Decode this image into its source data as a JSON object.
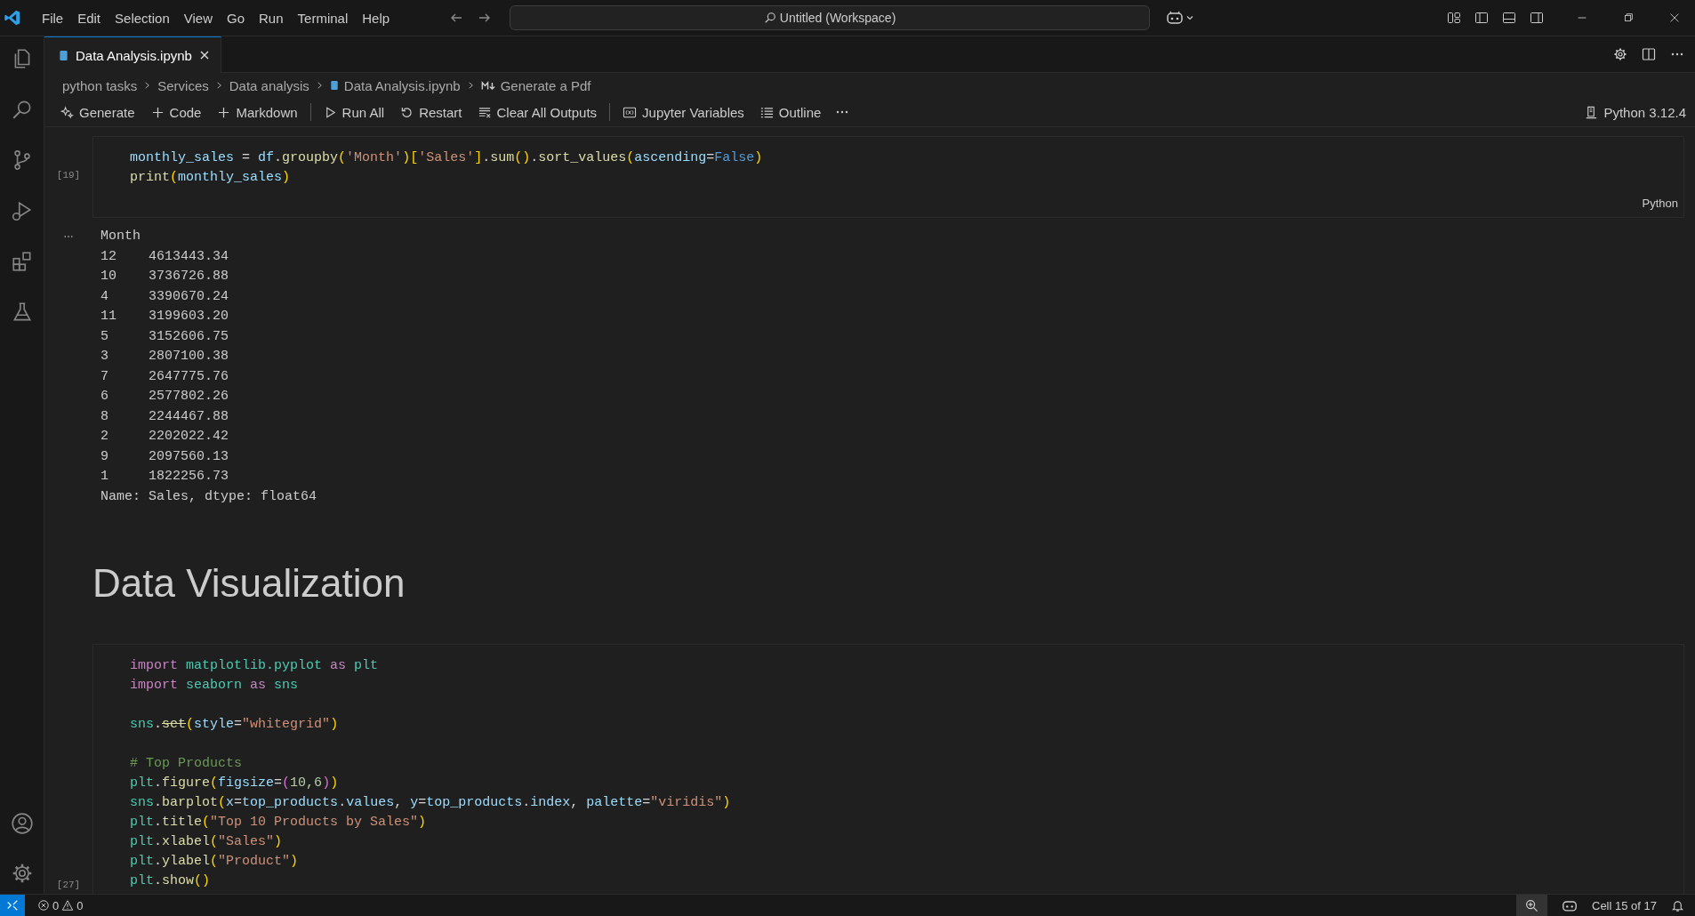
{
  "title_bar": {
    "menu": [
      "File",
      "Edit",
      "Selection",
      "View",
      "Go",
      "Run",
      "Terminal",
      "Help"
    ],
    "command_center": "Untitled (Workspace)"
  },
  "tabs": [
    {
      "label": "Data Analysis.ipynb",
      "selected": true
    }
  ],
  "breadcrumbs": [
    {
      "label": "python tasks",
      "kind": "folder"
    },
    {
      "label": "Services",
      "kind": "folder"
    },
    {
      "label": "Data analysis",
      "kind": "folder"
    },
    {
      "label": "Data Analysis.ipynb",
      "kind": "notebook"
    },
    {
      "label": "Generate a Pdf",
      "kind": "markdown"
    }
  ],
  "toolbar": {
    "groups": [
      [
        {
          "label": "Generate",
          "kind": "generate"
        },
        {
          "label": "Code",
          "kind": "add"
        },
        {
          "label": "Markdown",
          "kind": "add"
        }
      ],
      [
        {
          "label": "Run All",
          "kind": "run"
        },
        {
          "label": "Restart",
          "kind": "restart"
        },
        {
          "label": "Clear All Outputs",
          "kind": "clear"
        }
      ],
      [
        {
          "label": "Jupyter Variables",
          "kind": "variables"
        },
        {
          "label": "Outline",
          "kind": "outline"
        }
      ]
    ],
    "kernel": "Python 3.12.4"
  },
  "cells": [
    {
      "kind": "code",
      "execution_count": "[19]",
      "language": "Python",
      "lines": [
        {
          "tokens": [
            {
              "kind": "var",
              "text": "monthly_sales"
            },
            {
              "kind": "plain",
              "text": " = "
            },
            {
              "kind": "var",
              "text": "df"
            },
            {
              "kind": "plain",
              "text": "."
            },
            {
              "kind": "func",
              "text": "groupby"
            },
            {
              "kind": "bracket",
              "text": "("
            },
            {
              "kind": "string",
              "text": "'Month'"
            },
            {
              "kind": "bracket",
              "text": ")["
            },
            {
              "kind": "string",
              "text": "'Sales'"
            },
            {
              "kind": "bracket",
              "text": "]"
            },
            {
              "kind": "plain",
              "text": "."
            },
            {
              "kind": "func",
              "text": "sum"
            },
            {
              "kind": "bracket",
              "text": "()"
            },
            {
              "kind": "plain",
              "text": "."
            },
            {
              "kind": "func",
              "text": "sort_values"
            },
            {
              "kind": "bracket",
              "text": "("
            },
            {
              "kind": "param",
              "text": "ascending"
            },
            {
              "kind": "plain",
              "text": "="
            },
            {
              "kind": "const",
              "text": "False"
            },
            {
              "kind": "bracket",
              "text": ")"
            }
          ]
        },
        {
          "tokens": [
            {
              "kind": "func",
              "text": "print"
            },
            {
              "kind": "bracket",
              "text": "("
            },
            {
              "kind": "var",
              "text": "monthly_sales"
            },
            {
              "kind": "bracket",
              "text": ")"
            }
          ]
        }
      ],
      "output": [
        "Month",
        "12    4613443.34",
        "10    3736726.88",
        "4     3390670.24",
        "11    3199603.20",
        "5     3152606.75",
        "3     2807100.38",
        "7     2647775.76",
        "6     2577802.26",
        "8     2244467.88",
        "2     2202022.42",
        "9     2097560.13",
        "1     1822256.73",
        "Name: Sales, dtype: float64"
      ]
    },
    {
      "kind": "markdown",
      "heading": "Data Visualization"
    },
    {
      "kind": "code",
      "execution_count": "[27]",
      "lines": [
        {
          "tokens": [
            {
              "kind": "keyword",
              "text": "import "
            },
            {
              "kind": "module",
              "text": "matplotlib.pyplot "
            },
            {
              "kind": "keyword",
              "text": "as "
            },
            {
              "kind": "module",
              "text": "plt"
            }
          ]
        },
        {
          "tokens": [
            {
              "kind": "keyword",
              "text": "import "
            },
            {
              "kind": "module",
              "text": "seaborn "
            },
            {
              "kind": "keyword",
              "text": "as "
            },
            {
              "kind": "module",
              "text": "sns"
            }
          ]
        },
        {
          "gap_before": true,
          "tokens": [
            {
              "kind": "module",
              "text": "sns"
            },
            {
              "kind": "plain",
              "text": "."
            },
            {
              "kind": "deprecated",
              "text": "set"
            },
            {
              "kind": "bracket",
              "text": "("
            },
            {
              "kind": "param",
              "text": "style"
            },
            {
              "kind": "plain",
              "text": "="
            },
            {
              "kind": "string",
              "text": "\"whitegrid\""
            },
            {
              "kind": "bracket",
              "text": ")"
            }
          ]
        },
        {
          "gap_before": true,
          "tokens": [
            {
              "kind": "comment",
              "text": "# Top Products"
            }
          ]
        },
        {
          "tokens": [
            {
              "kind": "module",
              "text": "plt"
            },
            {
              "kind": "plain",
              "text": "."
            },
            {
              "kind": "func",
              "text": "figure"
            },
            {
              "kind": "bracket",
              "text": "("
            },
            {
              "kind": "param",
              "text": "figsize"
            },
            {
              "kind": "plain",
              "text": "="
            },
            {
              "kind": "bracket2",
              "text": "("
            },
            {
              "kind": "number",
              "text": "10,6"
            },
            {
              "kind": "bracket2",
              "text": ")"
            },
            {
              "kind": "bracket",
              "text": ")"
            }
          ]
        },
        {
          "tokens": [
            {
              "kind": "module",
              "text": "sns"
            },
            {
              "kind": "plain",
              "text": "."
            },
            {
              "kind": "func",
              "text": "barplot"
            },
            {
              "kind": "bracket",
              "text": "("
            },
            {
              "kind": "param",
              "text": "x"
            },
            {
              "kind": "plain",
              "text": "="
            },
            {
              "kind": "var",
              "text": "top_products"
            },
            {
              "kind": "plain",
              "text": "."
            },
            {
              "kind": "var",
              "text": "values"
            },
            {
              "kind": "plain",
              "text": ", "
            },
            {
              "kind": "param",
              "text": "y"
            },
            {
              "kind": "plain",
              "text": "="
            },
            {
              "kind": "var",
              "text": "top_products"
            },
            {
              "kind": "plain",
              "text": "."
            },
            {
              "kind": "var",
              "text": "index"
            },
            {
              "kind": "plain",
              "text": ", "
            },
            {
              "kind": "param",
              "text": "palette"
            },
            {
              "kind": "plain",
              "text": "="
            },
            {
              "kind": "string",
              "text": "\"viridis\""
            },
            {
              "kind": "bracket",
              "text": ")"
            }
          ]
        },
        {
          "tokens": [
            {
              "kind": "module",
              "text": "plt"
            },
            {
              "kind": "plain",
              "text": "."
            },
            {
              "kind": "func",
              "text": "title"
            },
            {
              "kind": "bracket",
              "text": "("
            },
            {
              "kind": "string",
              "text": "\"Top 10 Products by Sales\""
            },
            {
              "kind": "bracket",
              "text": ")"
            }
          ]
        },
        {
          "tokens": [
            {
              "kind": "module",
              "text": "plt"
            },
            {
              "kind": "plain",
              "text": "."
            },
            {
              "kind": "func",
              "text": "xlabel"
            },
            {
              "kind": "bracket",
              "text": "("
            },
            {
              "kind": "string",
              "text": "\"Sales\""
            },
            {
              "kind": "bracket",
              "text": ")"
            }
          ]
        },
        {
          "tokens": [
            {
              "kind": "module",
              "text": "plt"
            },
            {
              "kind": "plain",
              "text": "."
            },
            {
              "kind": "func",
              "text": "ylabel"
            },
            {
              "kind": "bracket",
              "text": "("
            },
            {
              "kind": "string",
              "text": "\"Product\""
            },
            {
              "kind": "bracket",
              "text": ")"
            }
          ]
        },
        {
          "tokens": [
            {
              "kind": "module",
              "text": "plt"
            },
            {
              "kind": "plain",
              "text": "."
            },
            {
              "kind": "func",
              "text": "show"
            },
            {
              "kind": "bracket",
              "text": "()"
            }
          ]
        }
      ]
    }
  ],
  "status_bar": {
    "errors": "0",
    "warnings": "0",
    "cell_position": "Cell 15 of 17"
  }
}
